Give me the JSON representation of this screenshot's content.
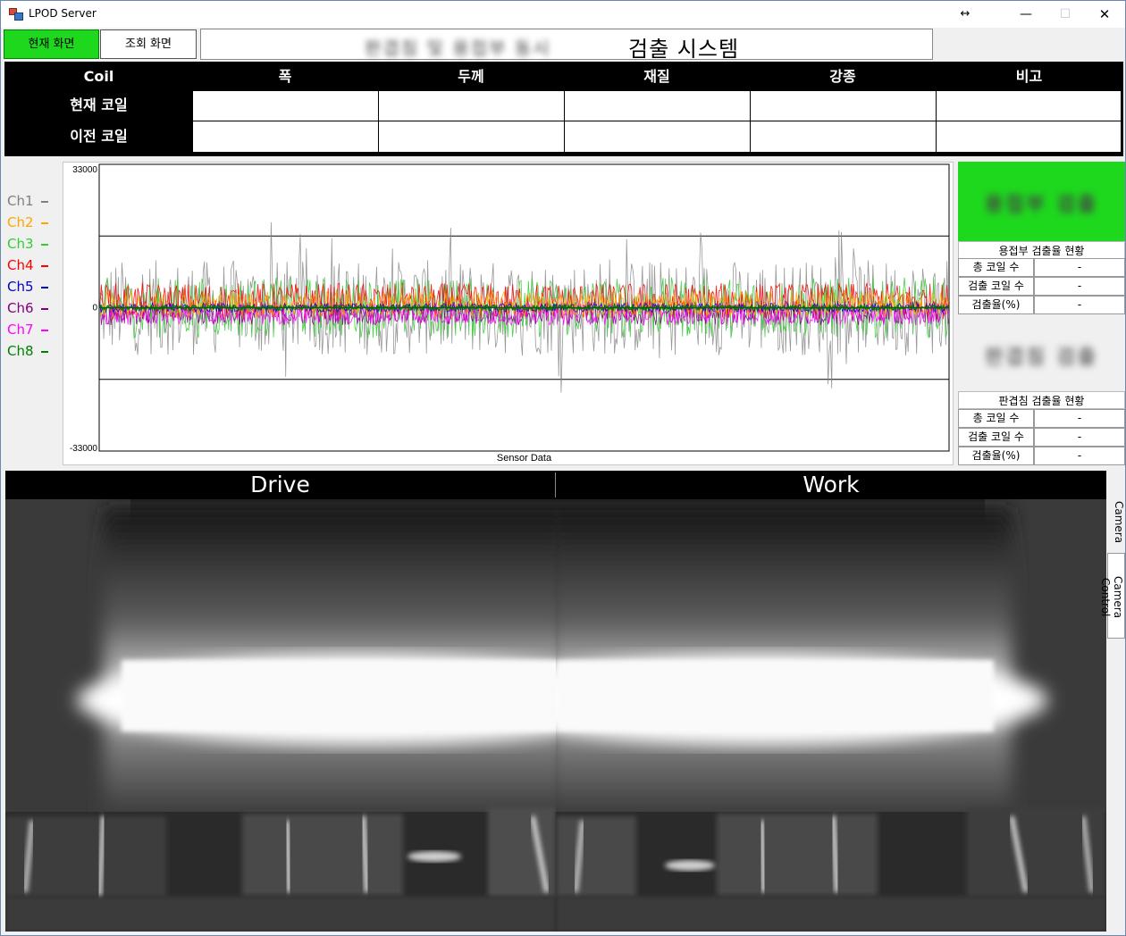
{
  "window": {
    "title": "LPOD Server",
    "resize_glyph": "↔",
    "min_glyph": "—",
    "max_glyph": "☐",
    "close_glyph": "✕"
  },
  "nav": {
    "current_screen": "현재 화면",
    "history_screen": "조회 화면"
  },
  "system_title": {
    "visible": "검출 시스템",
    "blurred": "판겹침 및 용접부 동시"
  },
  "coil_table": {
    "headers": [
      "Coil",
      "폭",
      "두께",
      "재질",
      "강종",
      "비고"
    ],
    "rows": [
      {
        "label": "현재 코일",
        "values": [
          "",
          "",
          "",
          "",
          ""
        ]
      },
      {
        "label": "이전 코일",
        "values": [
          "",
          "",
          "",
          "",
          ""
        ]
      }
    ]
  },
  "chart_data": {
    "type": "line",
    "xlabel": "Sensor Data",
    "ylim": [
      -33000,
      33000
    ],
    "y_ticks": [
      "33000",
      "0",
      "-33000"
    ],
    "reference_lines": [
      16500,
      -16500
    ],
    "series": [
      {
        "name": "Ch1",
        "color": "#808080"
      },
      {
        "name": "Ch2",
        "color": "#ffa500"
      },
      {
        "name": "Ch3",
        "color": "#32cd32"
      },
      {
        "name": "Ch4",
        "color": "#ff0000"
      },
      {
        "name": "Ch5",
        "color": "#0000cd"
      },
      {
        "name": "Ch6",
        "color": "#800080"
      },
      {
        "name": "Ch7",
        "color": "#ff00ff"
      },
      {
        "name": "Ch8",
        "color": "#008000"
      }
    ]
  },
  "weld_status": {
    "banner_blurred": "용접부 검출",
    "title": "용접부 검출율 현황",
    "rows": [
      {
        "label": "총 코일 수",
        "value": "-"
      },
      {
        "label": "검출 코일 수",
        "value": "-"
      },
      {
        "label": "검출율(%)",
        "value": "-"
      }
    ],
    "banner_color": "#1ed81e"
  },
  "seam_status": {
    "banner_blurred": "판겹침 검출",
    "title": "판겹침 검출율 현황",
    "rows": [
      {
        "label": "총 코일 수",
        "value": "-"
      },
      {
        "label": "검출 코일 수",
        "value": "-"
      },
      {
        "label": "검출율(%)",
        "value": "-"
      }
    ]
  },
  "camera": {
    "left_label": "Drive",
    "right_label": "Work"
  },
  "side_tabs": {
    "camera": "Camera",
    "camera_control": "Camera Control"
  }
}
